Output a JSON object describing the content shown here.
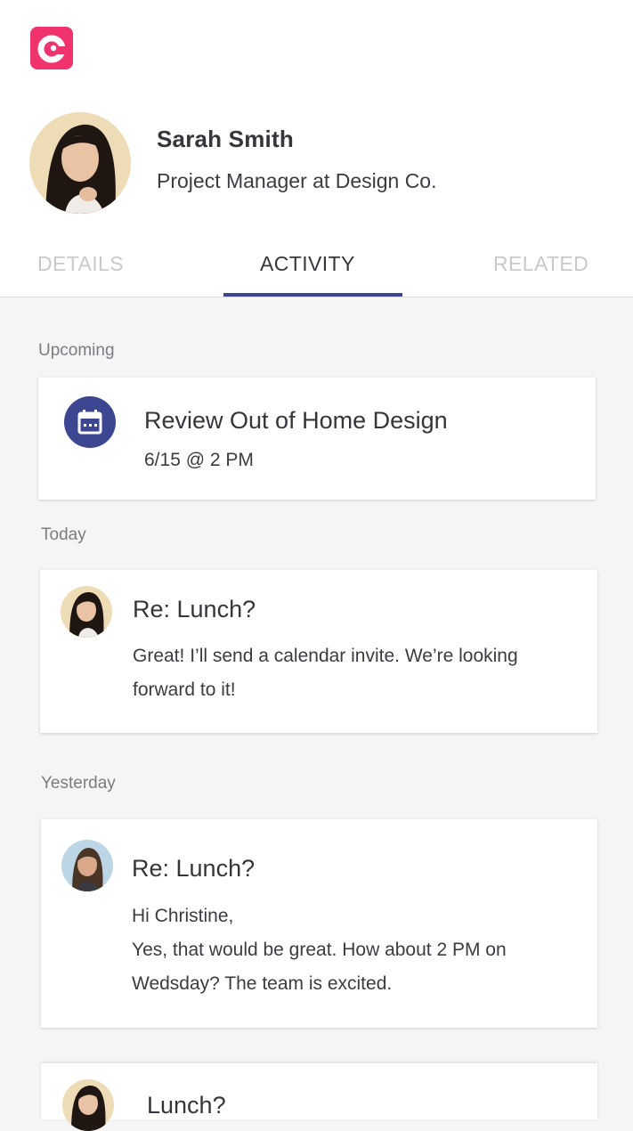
{
  "profile": {
    "name": "Sarah Smith",
    "title": "Project Manager at Design Co."
  },
  "tabs": [
    {
      "label": "DETAILS",
      "active": false
    },
    {
      "label": "ACTIVITY",
      "active": true
    },
    {
      "label": "RELATED",
      "active": false
    }
  ],
  "sections": {
    "upcoming": "Upcoming",
    "today": "Today",
    "yesterday": "Yesterday"
  },
  "upcoming_item": {
    "title": "Review Out of Home Design",
    "datetime": "6/15 @ 2 PM",
    "icon": "calendar-icon"
  },
  "today_item": {
    "subject": "Re: Lunch?",
    "body_line1": "Great! I’ll send a calendar invite. We’re looking",
    "body_line2": "forward to it!"
  },
  "yesterday_item": {
    "subject": "Re: Lunch?",
    "body_line1": "Hi Christine,",
    "body_line2": "Yes, that would be great. How about 2 PM on",
    "body_line3": "Wedsday? The team is excited."
  },
  "older_item": {
    "subject": "Lunch?"
  },
  "colors": {
    "brand": "#f0336c",
    "accent": "#3d4691",
    "background": "#f5f5f6"
  }
}
